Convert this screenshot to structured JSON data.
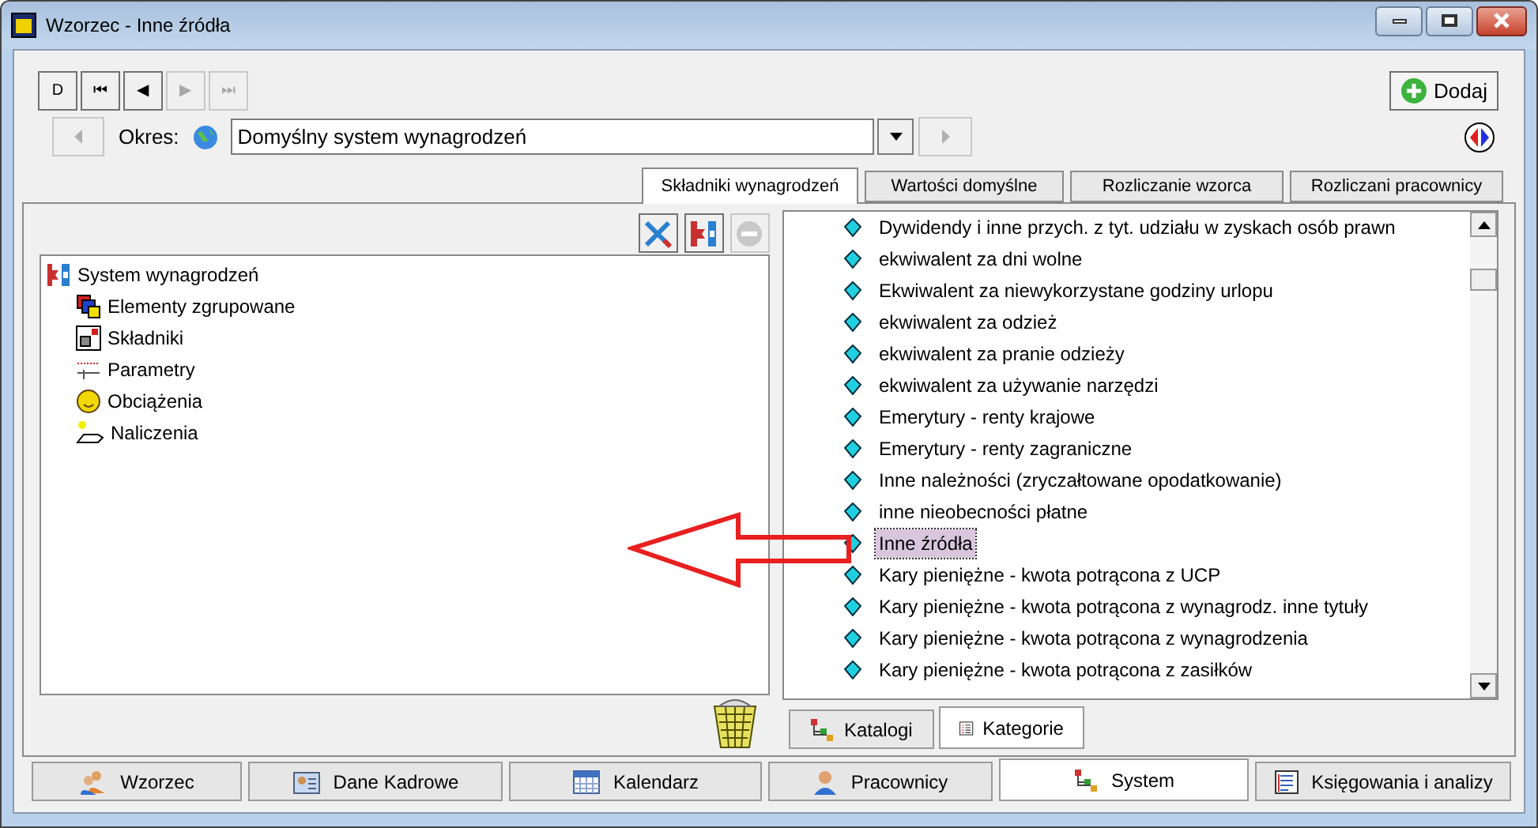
{
  "window": {
    "title": "Wzorzec - Inne źródła"
  },
  "nav_buttons": [
    {
      "label": "D",
      "disabled": false
    },
    {
      "label": "⏮",
      "disabled": false
    },
    {
      "label": "◀",
      "disabled": false
    },
    {
      "label": "▶",
      "disabled": true
    },
    {
      "label": "⏭",
      "disabled": true
    }
  ],
  "add_button": {
    "label": "Dodaj"
  },
  "period": {
    "label": "Okres:",
    "value": "Domyślny system wynagrodzeń",
    "back_disabled": true,
    "forward_disabled": true
  },
  "tabs": [
    {
      "label": "Składniki wynagrodzeń",
      "selected": true
    },
    {
      "label": "Wartości domyślne",
      "selected": false
    },
    {
      "label": "Rozliczanie wzorca",
      "selected": false
    },
    {
      "label": "Rozliczani pracownicy",
      "selected": false
    }
  ],
  "tree": {
    "label": "System wynagrodzeń",
    "children": [
      {
        "label": "Elementy zgrupowane"
      },
      {
        "label": "Składniki"
      },
      {
        "label": "Parametry"
      },
      {
        "label": "Obciążenia"
      },
      {
        "label": "Naliczenia"
      }
    ]
  },
  "items": [
    {
      "label": "Dywidendy i inne przych. z tyt. udziału w zyskach osób prawn",
      "selected": false
    },
    {
      "label": "ekwiwalent za dni wolne",
      "selected": false
    },
    {
      "label": "Ekwiwalent za niewykorzystane godziny urlopu",
      "selected": false
    },
    {
      "label": "ekwiwalent za odzież",
      "selected": false
    },
    {
      "label": "ekwiwalent za pranie odzieży",
      "selected": false
    },
    {
      "label": "ekwiwalent za używanie narzędzi",
      "selected": false
    },
    {
      "label": "Emerytury - renty krajowe",
      "selected": false
    },
    {
      "label": "Emerytury - renty zagraniczne",
      "selected": false
    },
    {
      "label": "Inne należności (zryczałtowane opodatkowanie)",
      "selected": false
    },
    {
      "label": "inne nieobecności płatne",
      "selected": false
    },
    {
      "label": "Inne źródła",
      "selected": true
    },
    {
      "label": "Kary pieniężne - kwota potrącona z UCP",
      "selected": false
    },
    {
      "label": "Kary pieniężne - kwota potrącona z wynagrodz. inne tytuły",
      "selected": false
    },
    {
      "label": "Kary pieniężne - kwota potrącona z wynagrodzenia",
      "selected": false
    },
    {
      "label": "Kary pieniężne - kwota potrącona z zasiłków",
      "selected": false
    }
  ],
  "sub_tabs": [
    {
      "label": "Katalogi",
      "selected": false
    },
    {
      "label": "Kategorie",
      "selected": true
    }
  ],
  "bottom_tabs": [
    {
      "label": "Wzorzec",
      "selected": false
    },
    {
      "label": "Dane Kadrowe",
      "selected": false
    },
    {
      "label": "Kalendarz",
      "selected": false
    },
    {
      "label": "Pracownicy",
      "selected": false
    },
    {
      "label": "System",
      "selected": true
    },
    {
      "label": "Księgowania i analizy",
      "selected": false
    }
  ]
}
